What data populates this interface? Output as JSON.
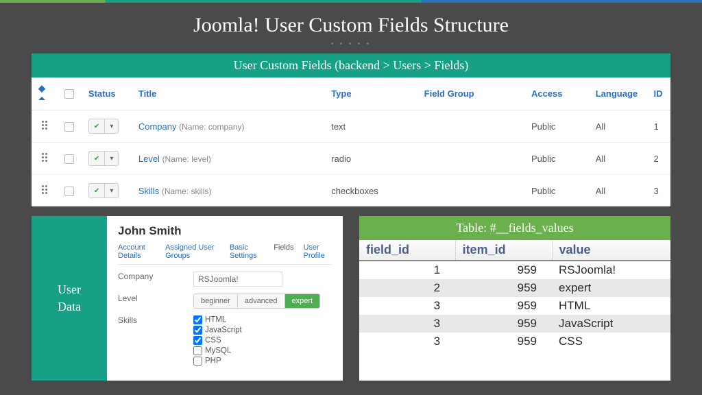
{
  "title": "Joomla! User Custom Fields Structure",
  "panel": {
    "header": "User Custom Fields (backend > Users > Fields)",
    "columns": {
      "status": "Status",
      "title": "Title",
      "type": "Type",
      "group": "Field Group",
      "access": "Access",
      "lang": "Language",
      "id": "ID"
    },
    "rows": [
      {
        "title": "Company",
        "name": "(Name: company)",
        "type": "text",
        "group": "",
        "access": "Public",
        "lang": "All",
        "id": "1"
      },
      {
        "title": "Level",
        "name": "(Name: level)",
        "type": "radio",
        "group": "",
        "access": "Public",
        "lang": "All",
        "id": "2"
      },
      {
        "title": "Skills",
        "name": "(Name: skills)",
        "type": "checkboxes",
        "group": "",
        "access": "Public",
        "lang": "All",
        "id": "3"
      }
    ]
  },
  "user": {
    "side": "User\nData",
    "name": "John Smith",
    "tabs": [
      "Account Details",
      "Assigned User Groups",
      "Basic Settings",
      "Fields",
      "User Profile"
    ],
    "active_tab": 3,
    "company_label": "Company",
    "company_value": "RSJoomla!",
    "level_label": "Level",
    "levels": [
      "beginner",
      "advanced",
      "expert"
    ],
    "level_selected": 2,
    "skills_label": "Skills",
    "skills": [
      {
        "label": "HTML",
        "checked": true
      },
      {
        "label": "JavaScript",
        "checked": true
      },
      {
        "label": "CSS",
        "checked": true
      },
      {
        "label": "MySQL",
        "checked": false
      },
      {
        "label": "PHP",
        "checked": false
      }
    ]
  },
  "db": {
    "header": "Table: #__fields_values",
    "columns": [
      "field_id",
      "item_id",
      "value"
    ],
    "rows": [
      [
        "1",
        "959",
        "RSJoomla!"
      ],
      [
        "2",
        "959",
        "expert"
      ],
      [
        "3",
        "959",
        "HTML"
      ],
      [
        "3",
        "959",
        "JavaScript"
      ],
      [
        "3",
        "959",
        "CSS"
      ]
    ]
  }
}
